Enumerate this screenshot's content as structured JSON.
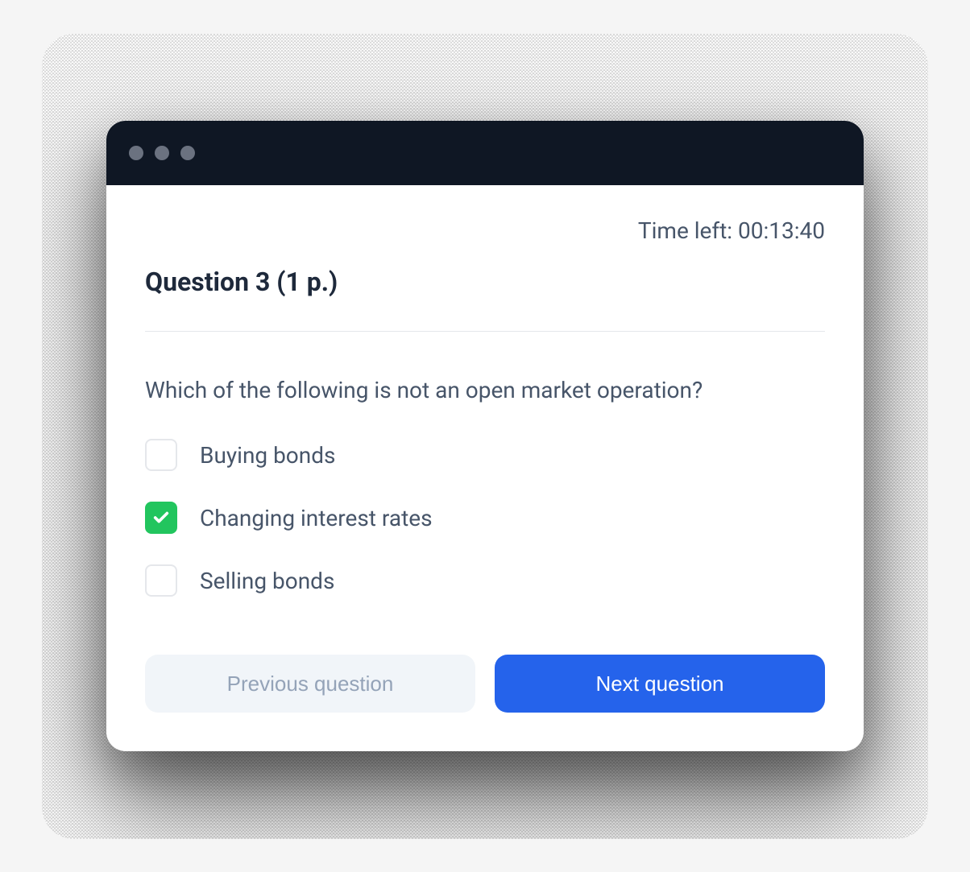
{
  "timer": {
    "label": "Time left: 00:13:40"
  },
  "header": {
    "title": "Question 3   (1 p.)"
  },
  "question": {
    "text": "Which of the following is not an open market operation?",
    "answers": [
      {
        "label": "Buying bonds",
        "checked": false
      },
      {
        "label": "Changing interest rates",
        "checked": true
      },
      {
        "label": "Selling bonds",
        "checked": false
      }
    ]
  },
  "buttons": {
    "previous": "Previous question",
    "next": "Next question"
  },
  "colors": {
    "titlebar": "#0f1724",
    "primary_button": "#2563eb",
    "checked": "#22c55e",
    "text_muted": "#475569"
  }
}
